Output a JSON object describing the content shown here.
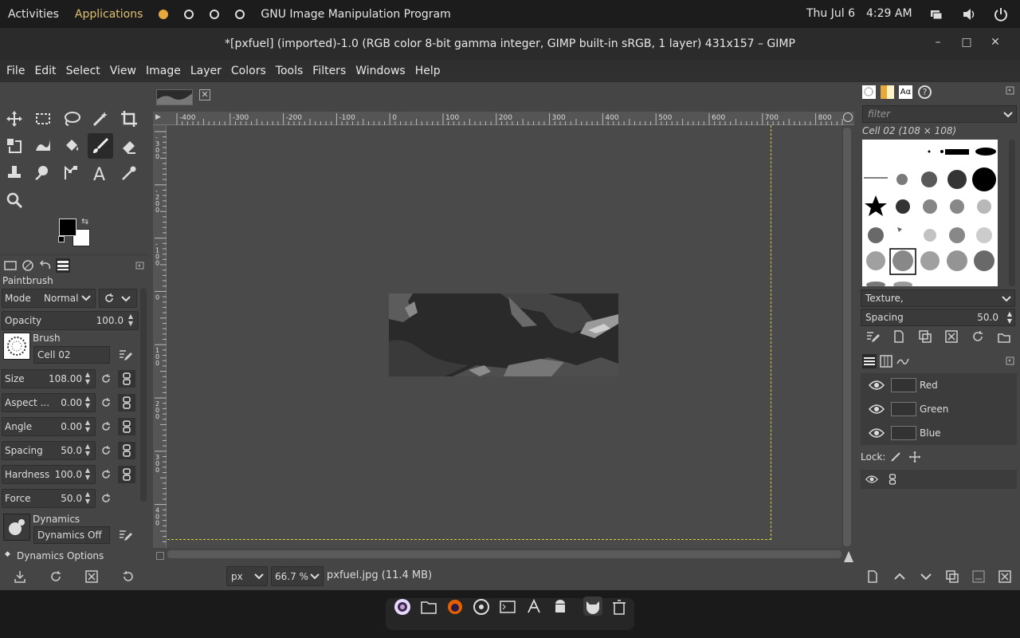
{
  "topbar": {
    "activities": "Activities",
    "applications": "Applications",
    "app_name": "GNU Image Manipulation Program",
    "date": "Thu Jul 6",
    "time": "4:29 AM"
  },
  "window": {
    "title": "*[pxfuel] (imported)-1.0 (RGB color 8-bit gamma integer, GIMP built-in sRGB, 1 layer) 431x157 – GIMP",
    "minimize": "–",
    "maximize": "□",
    "close": "✕"
  },
  "menu": [
    "File",
    "Edit",
    "Select",
    "View",
    "Image",
    "Layer",
    "Colors",
    "Tools",
    "Filters",
    "Windows",
    "Help"
  ],
  "tool_options": {
    "title": "Paintbrush",
    "mode_label": "Mode",
    "mode_value": "Normal",
    "opacity_label": "Opacity",
    "opacity_value": "100.0",
    "brush_label": "Brush",
    "brush_value": "Cell 02",
    "size_label": "Size",
    "size_value": "108.00",
    "aspect_label": "Aspect ...",
    "aspect_value": "0.00",
    "angle_label": "Angle",
    "angle_value": "0.00",
    "spacing_label": "Spacing",
    "spacing_value": "50.0",
    "hardness_label": "Hardness",
    "hardness_value": "100.0",
    "force_label": "Force",
    "force_value": "50.0",
    "dynamics_label": "Dynamics",
    "dynamics_value": "Dynamics Off",
    "dynamics_options": "Dynamics Options"
  },
  "ruler": {
    "h_ticks": [
      "-400",
      "-300",
      "-200",
      "-100",
      "0",
      "100",
      "200",
      "300",
      "400",
      "500",
      "600",
      "700",
      "800"
    ],
    "v_ticks": [
      "-300",
      "-200",
      "-100",
      "0",
      "100",
      "200",
      "300",
      "400"
    ]
  },
  "status": {
    "unit": "px",
    "zoom": "66.7 %",
    "file": "pxfuel.jpg (11.4 MB)"
  },
  "brushes": {
    "filter_placeholder": "filter",
    "selected": "Cell 02 (108 × 108)",
    "tag": "Texture,",
    "spacing_label": "Spacing",
    "spacing_value": "50.0"
  },
  "channels": [
    {
      "name": "Red"
    },
    {
      "name": "Green"
    },
    {
      "name": "Blue"
    }
  ],
  "layers": {
    "lock_label": "Lock:"
  }
}
